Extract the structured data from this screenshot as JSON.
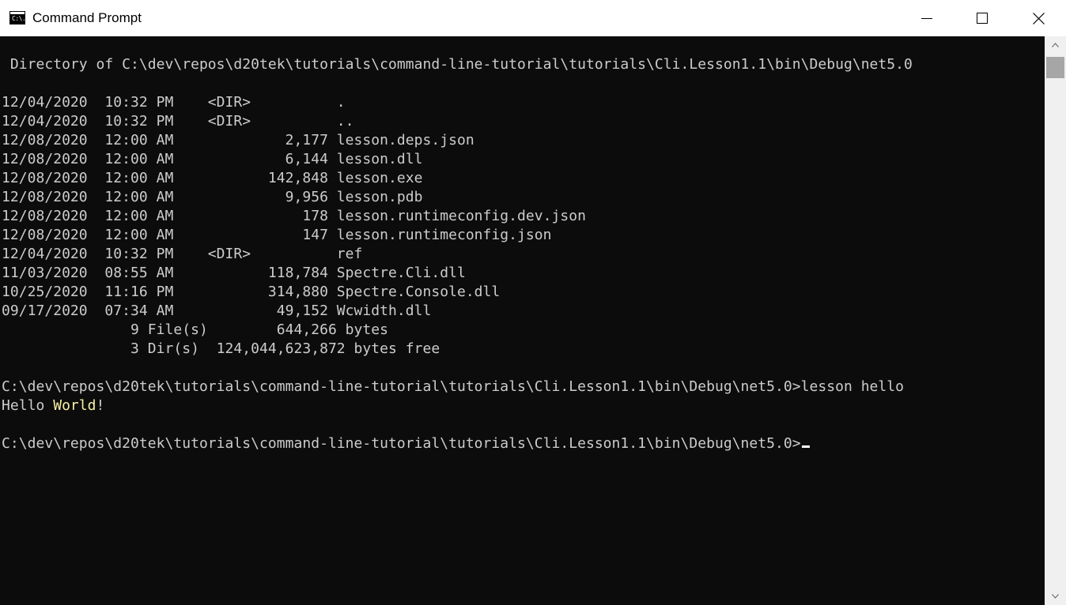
{
  "window": {
    "title": "Command Prompt",
    "app_icon_text": "C:\\.",
    "controls": [
      "minimize-icon",
      "maximize-icon",
      "close-icon"
    ]
  },
  "colors": {
    "background": "#0c0c0c",
    "text": "#cccccc",
    "highlight": "#f9f1a5",
    "titlebar": "#ffffff"
  },
  "console": {
    "dir_header": " Directory of C:\\dev\\repos\\d20tek\\tutorials\\command-line-tutorial\\tutorials\\Cli.Lesson1.1\\bin\\Debug\\net5.0",
    "listing": [
      "12/04/2020  10:32 PM    <DIR>          .",
      "12/04/2020  10:32 PM    <DIR>          ..",
      "12/08/2020  12:00 AM             2,177 lesson.deps.json",
      "12/08/2020  12:00 AM             6,144 lesson.dll",
      "12/08/2020  12:00 AM           142,848 lesson.exe",
      "12/08/2020  12:00 AM             9,956 lesson.pdb",
      "12/08/2020  12:00 AM               178 lesson.runtimeconfig.dev.json",
      "12/08/2020  12:00 AM               147 lesson.runtimeconfig.json",
      "12/04/2020  10:32 PM    <DIR>          ref",
      "11/03/2020  08:55 AM           118,784 Spectre.Cli.dll",
      "10/25/2020  11:16 PM           314,880 Spectre.Console.dll",
      "09/17/2020  07:34 AM            49,152 Wcwidth.dll",
      "               9 File(s)        644,266 bytes",
      "               3 Dir(s)  124,044,623,872 bytes free"
    ],
    "prompt": "C:\\dev\\repos\\d20tek\\tutorials\\command-line-tutorial\\tutorials\\Cli.Lesson1.1\\bin\\Debug\\net5.0>",
    "command": "lesson hello",
    "output_prefix": "Hello ",
    "output_highlight": "World",
    "output_suffix": "!"
  }
}
